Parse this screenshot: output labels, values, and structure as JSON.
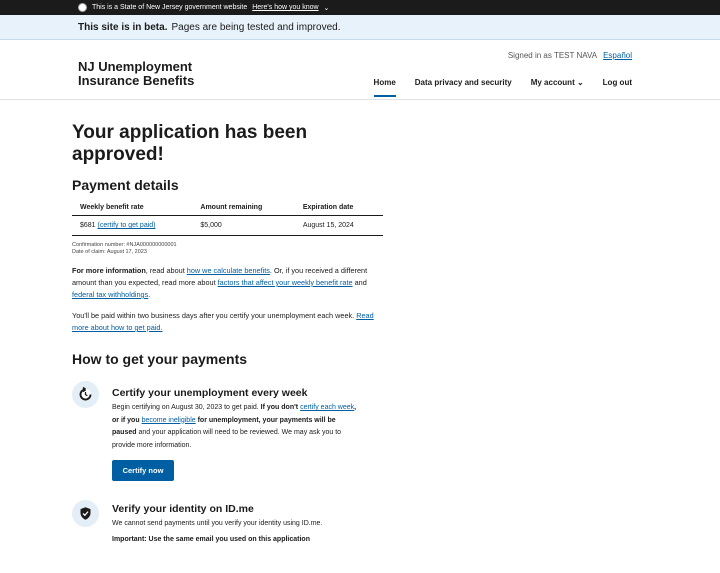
{
  "gov_banner": {
    "text": "This is a State of New Jersey government website",
    "link": "Here's how you know"
  },
  "beta_banner": {
    "strong": "This site is in beta.",
    "text": "Pages are being tested and improved."
  },
  "header": {
    "site_title": "NJ Unemployment Insurance Benefits",
    "signed_in": "Signed in as TEST NAVA",
    "language": "Español",
    "nav": [
      "Home",
      "Data privacy and security",
      "My account",
      "Log out"
    ]
  },
  "main": {
    "title": "Your application has been approved!",
    "payment_details_title": "Payment details",
    "table": {
      "headers": [
        "Weekly benefit rate",
        "Amount remaining",
        "Expiration date"
      ],
      "row": {
        "rate": "$681",
        "certify_link": "(certify to get paid)",
        "remaining": "$5,000",
        "expiration": "August 15, 2024"
      }
    },
    "confirmation": "Confirmation number: #NJA000000000001",
    "claim_date": "Date of claim: August 17, 2023",
    "more_info": {
      "strong": "For more information",
      "t1": ", read about ",
      "l1": "how we calculate benefits",
      "t2": ". Or, if you received a different amount than you expected, read more about ",
      "l2": "factors that affect your weekly benefit rate",
      "t3": " and ",
      "l3": "federal tax withholdings",
      "t4": "."
    },
    "paid_info": {
      "text": "You'll be paid within two business days after you certify your unemployment each week. ",
      "link": "Read more about how to get paid."
    },
    "how_title": "How to get your payments",
    "step1": {
      "title": "Certify your unemployment every week",
      "t1": "Begin certifying on August 30, 2023 to get paid. ",
      "b1": "If you don't ",
      "l1": "certify each week",
      "b2": ", or if you ",
      "l2": "become ineligible",
      "b3": " for unemployment, your payments will be paused",
      "t2": " and your application will need to be reviewed. We may ask you to provide more information.",
      "button": "Certify now"
    },
    "step2": {
      "title": "Verify your identity on ID.me",
      "text": "We cannot send payments until you verify your identity using ID.me.",
      "important": "Important: Use the same email you used on this application"
    }
  }
}
